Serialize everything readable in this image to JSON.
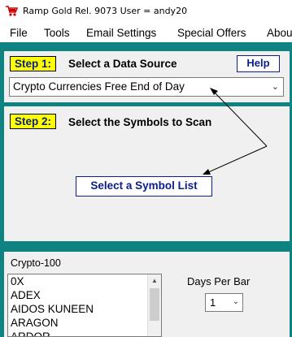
{
  "window": {
    "title": "Ramp Gold Rel. 9073   User  = andy20"
  },
  "menu": [
    "File",
    "Tools",
    "Email Settings",
    "Special Offers",
    "About"
  ],
  "step1": {
    "badge": "Step 1:",
    "text": "Select a Data Source",
    "help_label": "Help",
    "data_source": "Crypto Currencies Free End of Day"
  },
  "step2": {
    "badge": "Step 2:",
    "text": "Select the Symbols to Scan",
    "button_label": "Select a Symbol List"
  },
  "symbols": {
    "list_name": "Crypto-100",
    "items": [
      "0X",
      "ADEX",
      "AIDOS KUNEEN",
      "ARAGON",
      "ARDOR"
    ]
  },
  "days_per_bar": {
    "label": "Days Per Bar",
    "value": "1"
  },
  "colors": {
    "frame": "#0f8282",
    "badge": "#ffff00",
    "accent": "#0b1e8a"
  },
  "icons": {
    "app": "cart-icon",
    "chevron": "chevron-down-icon"
  }
}
